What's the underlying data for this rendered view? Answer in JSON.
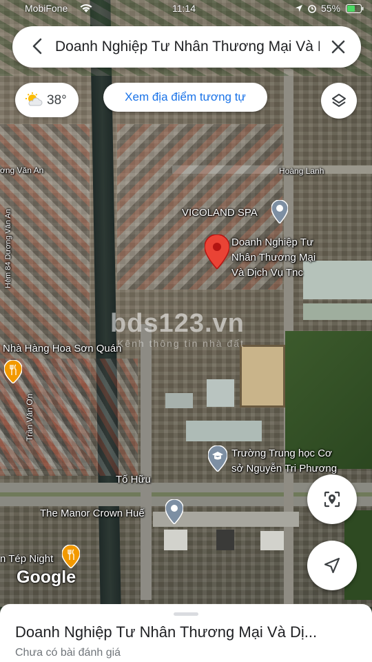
{
  "status_bar": {
    "carrier": "MobiFone",
    "time": "11:14",
    "battery": "55%"
  },
  "search": {
    "query": "Doanh Nghiệp Tư Nhân Thương Mại Và Dịch Vụ Tnc"
  },
  "weather": {
    "temperature": "38°",
    "icon": "partly-sunny-icon"
  },
  "similar_places_chip": "Xem địa điểm tương tự",
  "map_labels": {
    "street_van_an_top": "ơng Văn An",
    "alley_84": "Hẻm 84 Dương Văn An",
    "hoang_lanh": "Hoàng Lanh",
    "to_huu": "Tố Hữu",
    "tran_van_on": "Trần Văn Ơn"
  },
  "pois": {
    "vicoland": "VICOLAND SPA",
    "selected_line1": "Doanh Nghiệp Tư",
    "selected_line2": "Nhân Thương Mại",
    "selected_line3": "Và Dịch Vụ Tnc",
    "restaurant_hoa_son": "Nhà Hàng Hoa Sơn Quán",
    "school_line1": "Trường Trung học Cơ",
    "school_line2": "sở Nguyễn Tri Phương",
    "manor": "The Manor Crown Huế",
    "tep_night": "n Tép Night"
  },
  "watermark": {
    "main": "bds123.vn",
    "sub": "Kênh thông tin nhà đất"
  },
  "google_logo": "Google",
  "place_sheet": {
    "title": "Doanh Nghiệp Tư Nhân Thương Mại Và Dị...",
    "reviews": "Chưa có bài đánh giá"
  },
  "colors": {
    "pin_red": "#ea4335",
    "accent_blue": "#1a73e8"
  }
}
